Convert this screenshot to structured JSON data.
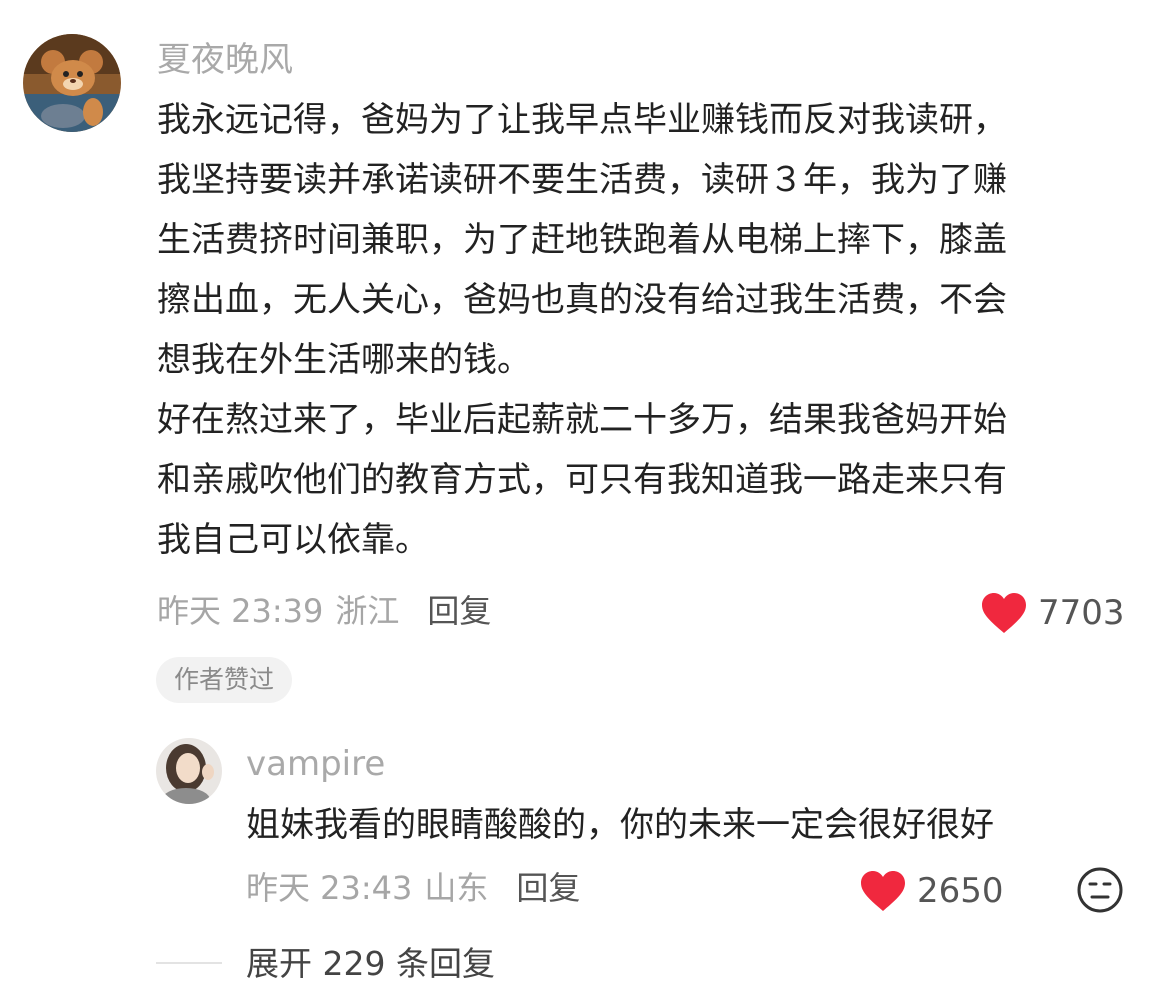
{
  "comment": {
    "username": "夏夜晚风",
    "lines": [
      "我永远记得，爸妈为了让我早点毕业赚钱而反对我读研，",
      "我坚持要读并承诺读研不要生活费，读研３年，我为了赚",
      "生活费挤时间兼职，为了赶地铁跑着从电梯上摔下，膝盖",
      "擦出血，无人关心，爸妈也真的没有给过我生活费，不会",
      "想我在外生活哪来的钱。",
      "好在熬过来了，毕业后起薪就二十多万，结果我爸妈开始",
      "和亲戚吹他们的教育方式，可只有我知道我一路走来只有",
      "我自己可以依靠。"
    ],
    "time": "昨天 23:39",
    "location": "浙江",
    "reply_label": "回复",
    "likes": "7703",
    "author_badge": "作者赞过",
    "avatar_icon": "cartoon-avatar-icon"
  },
  "reply": {
    "username": "vampire",
    "text": "姐妹我看的眼睛酸酸的，你的未来一定会很好很好",
    "time": "昨天 23:43",
    "location": "山东",
    "reply_label": "回复",
    "likes": "2650",
    "avatar_icon": "portrait-avatar-icon"
  },
  "expand_label": "展开 229 条回复",
  "colors": {
    "heart": "#f0283e",
    "muted_text": "#a6a6a6",
    "body_text": "#222222"
  }
}
